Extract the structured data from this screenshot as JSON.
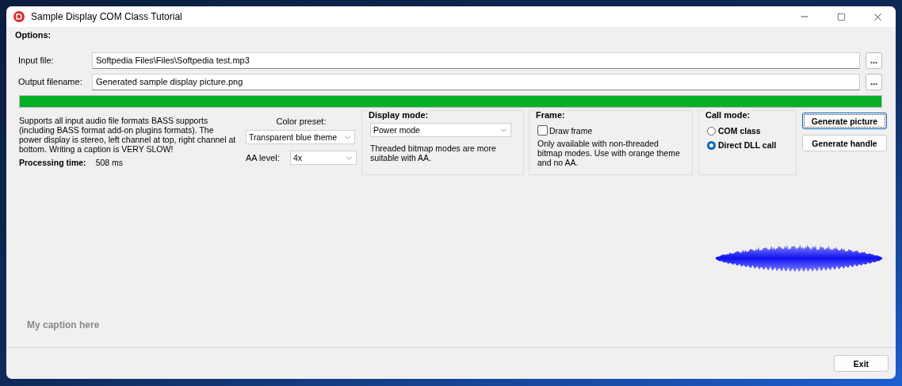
{
  "window": {
    "title": "Sample Display COM Class Tutorial"
  },
  "options": {
    "title": "Options:",
    "files": [
      {
        "label": "Input file:",
        "value": "Softpedia Files\\Files\\Softpedia test.mp3",
        "button": "..."
      },
      {
        "label": "Output filename:",
        "value": "Generated sample display picture.png",
        "button": "..."
      }
    ],
    "progress": {
      "level": 1
    }
  },
  "description": "Supports all input audio file formats BASS supports (including BASS format add-on plugins formats). The power display is stereo, left channel at top, right channel at bottom. Writing a caption is VERY SLOW!",
  "processing": {
    "label": "Processing time:",
    "value": "508 ms"
  },
  "color_preset": {
    "label": "Color preset:",
    "value": "Transparent blue theme"
  },
  "aa_level": {
    "label": "AA level:",
    "value": "4x"
  },
  "display_mode": {
    "title": "Display mode:",
    "value": "Power mode",
    "note": "Threaded bitmap modes are more suitable with AA."
  },
  "frame": {
    "title": "Frame:",
    "checkbox": {
      "label": "Draw frame",
      "checked": false
    },
    "note": "Only available with non-threaded bitmap modes. Use with orange theme and no AA."
  },
  "call_mode": {
    "title": "Call mode:",
    "options": [
      {
        "label": "COM class",
        "selected": false
      },
      {
        "label": "Direct DLL call",
        "selected": true
      }
    ]
  },
  "buttons": [
    {
      "label": "Generate picture",
      "focused": true
    },
    {
      "label": "Generate handle",
      "focused": false
    }
  ],
  "caption": "My caption here",
  "exit_button": "Exit"
}
